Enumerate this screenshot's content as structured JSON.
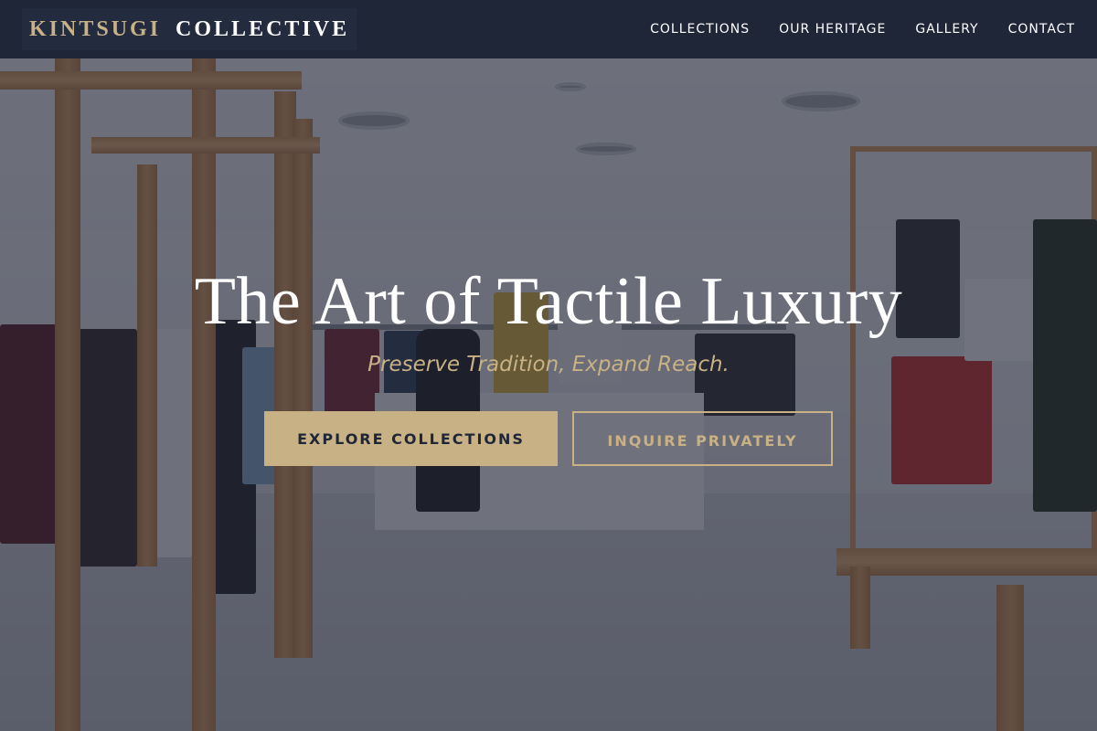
{
  "brand": {
    "part1": "KINTSUGI",
    "part2": "COLLECTIVE",
    "accent_color": "#c8b185",
    "navbar_color": "#1f2638"
  },
  "nav": {
    "items": [
      {
        "label": "COLLECTIONS"
      },
      {
        "label": "OUR HERITAGE"
      },
      {
        "label": "GALLERY"
      },
      {
        "label": "CONTACT"
      }
    ]
  },
  "hero": {
    "title": "The Art of Tactile Luxury",
    "subtitle": "Preserve Tradition, Expand Reach.",
    "primary_cta": "EXPLORE COLLECTIONS",
    "secondary_cta": "INQUIRE PRIVATELY"
  }
}
